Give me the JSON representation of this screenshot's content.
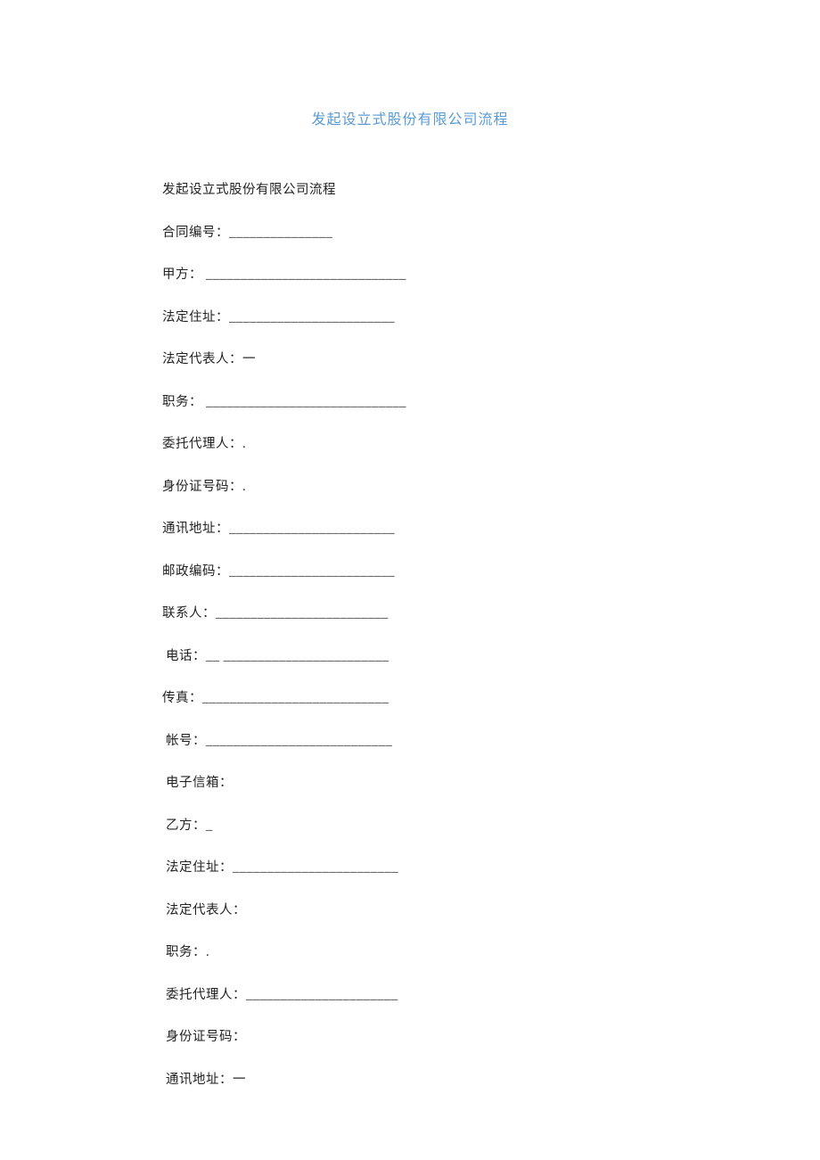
{
  "title": "发起设立式股份有限公司流程",
  "lines": [
    "发起设立式股份有限公司流程",
    "合同编号：_______________",
    "甲方： _____________________________",
    "法定住址：________________________",
    "法定代表人：一",
    "职务： _____________________________",
    "委托代理人：.",
    "身份证号码：.",
    "通讯地址：________________________",
    "邮政编码：________________________",
    "联系人：_________________________",
    " 电话：__  ________________________",
    "传真：___________________________",
    " 帐号：___________________________",
    " 电子信箱：",
    " 乙方：_",
    " 法定住址：________________________",
    " 法定代表人：",
    " 职务：.",
    " 委托代理人：______________________",
    " 身份证号码：",
    " 通讯地址：一"
  ]
}
